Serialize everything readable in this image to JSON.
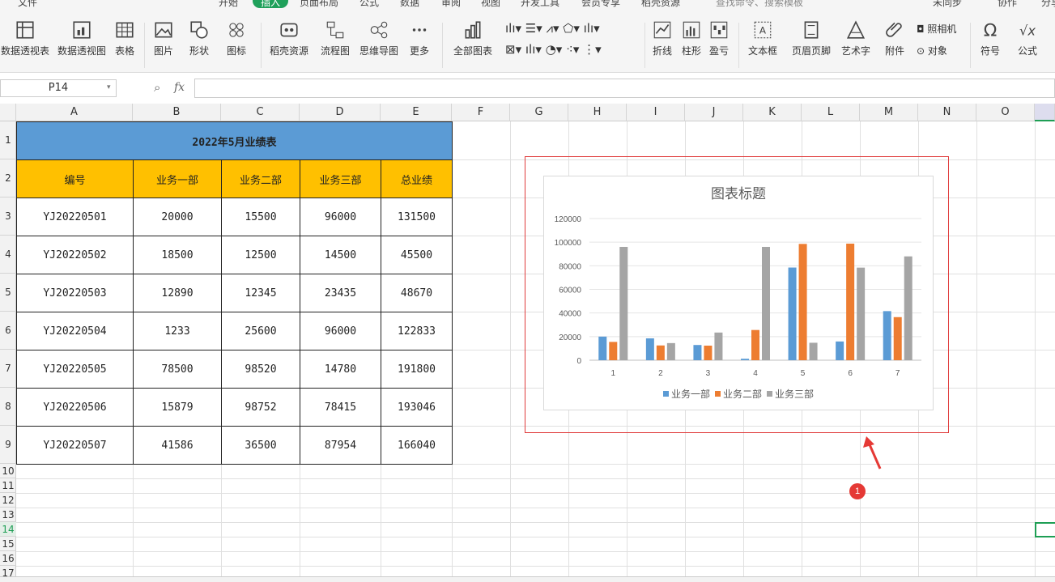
{
  "menu": {
    "items": [
      "文件",
      "开始",
      "插入",
      "页面布局",
      "公式",
      "数据",
      "审阅",
      "视图",
      "开发工具",
      "会员专享",
      "稻壳资源"
    ],
    "active": "插入",
    "search_placeholder": "查找命令、搜索模板",
    "sync": "未同步",
    "collab": "协作",
    "share": "分享"
  },
  "ribbon": {
    "pivot_table": "数据透视表",
    "pivot_chart": "数据透视图",
    "table": "表格",
    "picture": "图片",
    "shape": "形状",
    "icon": "图标",
    "docer": "稻壳资源",
    "flowchart": "流程图",
    "mindmap": "思维导图",
    "more": "更多",
    "all_charts": "全部图表",
    "line": "折线",
    "column": "柱形",
    "winloss": "盈亏",
    "textbox": "文本框",
    "header_footer": "页眉页脚",
    "wordart": "艺术字",
    "attachment": "附件",
    "camera": "照相机",
    "object": "对象",
    "symbol": "符号",
    "formula": "公式"
  },
  "formula_bar": {
    "name_box": "P14",
    "fx": "fx",
    "value": ""
  },
  "columns": [
    "A",
    "B",
    "C",
    "D",
    "E",
    "F",
    "G",
    "H",
    "I",
    "J",
    "K",
    "L",
    "M",
    "N",
    "O"
  ],
  "rows": [
    "1",
    "2",
    "3",
    "4",
    "5",
    "6",
    "7",
    "8",
    "9",
    "10",
    "11",
    "12",
    "13",
    "14",
    "15",
    "16",
    "17"
  ],
  "sheet": {
    "title": "2022年5月业绩表",
    "headers": [
      "编号",
      "业务一部",
      "业务二部",
      "业务三部",
      "总业绩"
    ],
    "rows": [
      [
        "YJ20220501",
        "20000",
        "15500",
        "96000",
        "131500"
      ],
      [
        "YJ20220502",
        "18500",
        "12500",
        "14500",
        "45500"
      ],
      [
        "YJ20220503",
        "12890",
        "12345",
        "23435",
        "48670"
      ],
      [
        "YJ20220504",
        "1233",
        "25600",
        "96000",
        "122833"
      ],
      [
        "YJ20220505",
        "78500",
        "98520",
        "14780",
        "191800"
      ],
      [
        "YJ20220506",
        "15879",
        "98752",
        "78415",
        "193046"
      ],
      [
        "YJ20220507",
        "41586",
        "36500",
        "87954",
        "166040"
      ]
    ]
  },
  "chart_data": {
    "type": "bar",
    "title": "图表标题",
    "categories": [
      "1",
      "2",
      "3",
      "4",
      "5",
      "6",
      "7"
    ],
    "series": [
      {
        "name": "业务一部",
        "color": "#5b9bd5",
        "values": [
          20000,
          18500,
          12890,
          1233,
          78500,
          15879,
          41586
        ]
      },
      {
        "name": "业务二部",
        "color": "#ed7d31",
        "values": [
          15500,
          12500,
          12345,
          25600,
          98520,
          98752,
          36500
        ]
      },
      {
        "name": "业务三部",
        "color": "#a5a5a5",
        "values": [
          96000,
          14500,
          23435,
          96000,
          14780,
          78415,
          87954
        ]
      }
    ],
    "yticks": [
      "0",
      "20000",
      "40000",
      "60000",
      "80000",
      "100000",
      "120000"
    ],
    "ylim": [
      0,
      120000
    ],
    "legend": "bottom",
    "grid": true
  },
  "annotation": {
    "badge": "1",
    "color": "#e53935"
  }
}
